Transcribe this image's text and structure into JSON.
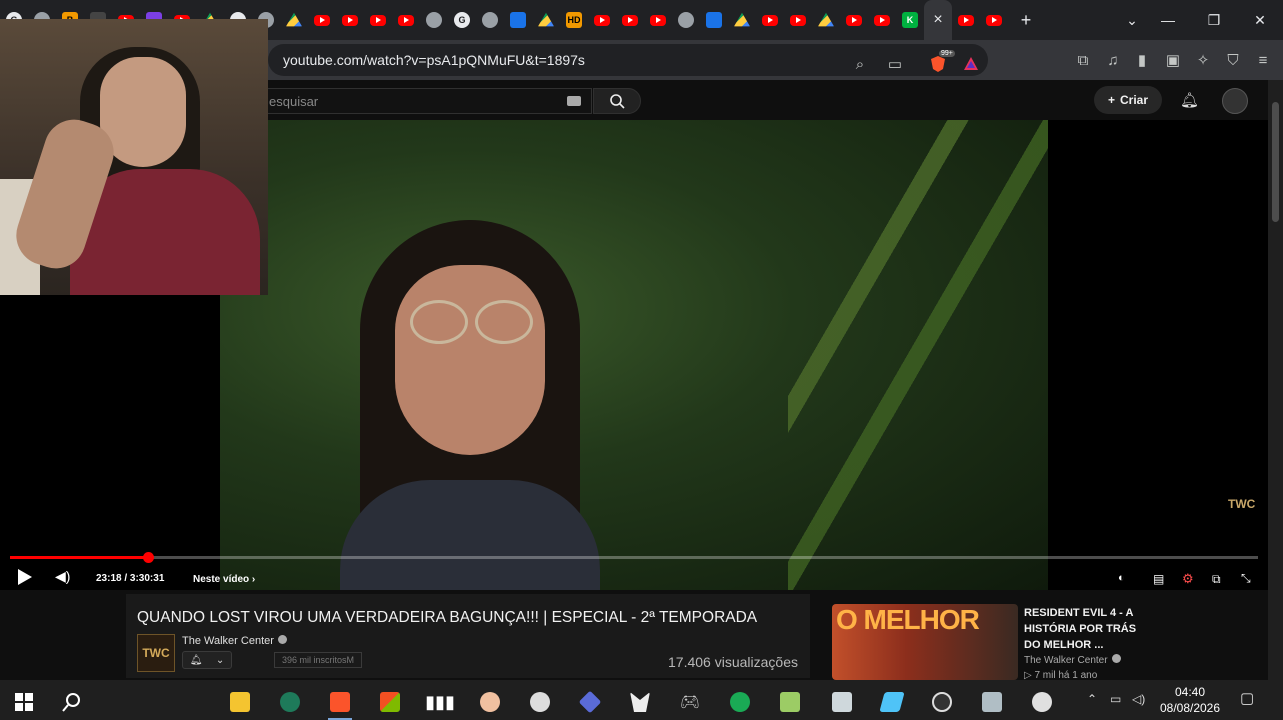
{
  "browser": {
    "url": "youtube.com/watch?v=psA1pQNMuFU&t=1897s",
    "tabs": [
      {
        "kind": "white",
        "glyph": "G"
      },
      {
        "kind": "gray",
        "glyph": ""
      },
      {
        "kind": "orange",
        "glyph": "B"
      },
      {
        "kind": "dark",
        "glyph": ""
      },
      {
        "kind": "yt",
        "glyph": ""
      },
      {
        "kind": "purple",
        "glyph": ""
      },
      {
        "kind": "yt",
        "glyph": ""
      },
      {
        "kind": "drive",
        "glyph": ""
      },
      {
        "kind": "white",
        "glyph": ""
      },
      {
        "kind": "gray",
        "glyph": ""
      },
      {
        "kind": "drive",
        "glyph": ""
      },
      {
        "kind": "yt",
        "glyph": ""
      },
      {
        "kind": "yt",
        "glyph": ""
      },
      {
        "kind": "yt",
        "glyph": ""
      },
      {
        "kind": "yt",
        "glyph": ""
      },
      {
        "kind": "gray",
        "glyph": ""
      },
      {
        "kind": "white",
        "glyph": "G"
      },
      {
        "kind": "gray",
        "glyph": ""
      },
      {
        "kind": "blue",
        "glyph": ""
      },
      {
        "kind": "drive",
        "glyph": ""
      },
      {
        "kind": "orange",
        "glyph": "HD"
      },
      {
        "kind": "yt",
        "glyph": ""
      },
      {
        "kind": "yt",
        "glyph": ""
      },
      {
        "kind": "yt",
        "glyph": ""
      },
      {
        "kind": "gray",
        "glyph": ""
      },
      {
        "kind": "blue",
        "glyph": ""
      },
      {
        "kind": "drive",
        "glyph": ""
      },
      {
        "kind": "yt",
        "glyph": ""
      },
      {
        "kind": "yt",
        "glyph": ""
      },
      {
        "kind": "drive",
        "glyph": ""
      },
      {
        "kind": "yt",
        "glyph": ""
      },
      {
        "kind": "yt",
        "glyph": ""
      },
      {
        "kind": "green",
        "glyph": "K"
      }
    ],
    "active_tab_close": "×",
    "after_tabs": [
      {
        "kind": "yt",
        "glyph": ""
      },
      {
        "kind": "yt",
        "glyph": ""
      }
    ],
    "new_tab": "+",
    "brave_badge": "99+"
  },
  "youtube": {
    "search_placeholder": "esquisar",
    "create_label": "Criar"
  },
  "player": {
    "time": "23:18 / 3:30:31",
    "chapter": "Neste vídeo",
    "progress_fraction": 0.1106,
    "watermark": "TWC"
  },
  "video_info": {
    "title": "QUANDO LOST VIROU UMA VERDADEIRA BAGUNÇA!!! | ESPECIAL - 2ª TEMPORADA",
    "channel_avatar": "TWC",
    "channel": "The Walker Center",
    "subscribers": "396 mil inscritosM",
    "views": "17.406 visualizações"
  },
  "recommendation": {
    "thumb_text": "O MELHOR",
    "title": "RESIDENT EVIL 4 - A HISTÓRIA POR TRÁS DO MELHOR ...",
    "channel": "The Walker Center",
    "meta": "▷ 7 mil  há 1 ano"
  },
  "taskbar": {
    "time": "04:40",
    "date": "08/08/2026"
  },
  "colors": {
    "progress": "#ff0000",
    "yt_bg": "#0f0f0f",
    "chrome_bg": "#202124"
  }
}
